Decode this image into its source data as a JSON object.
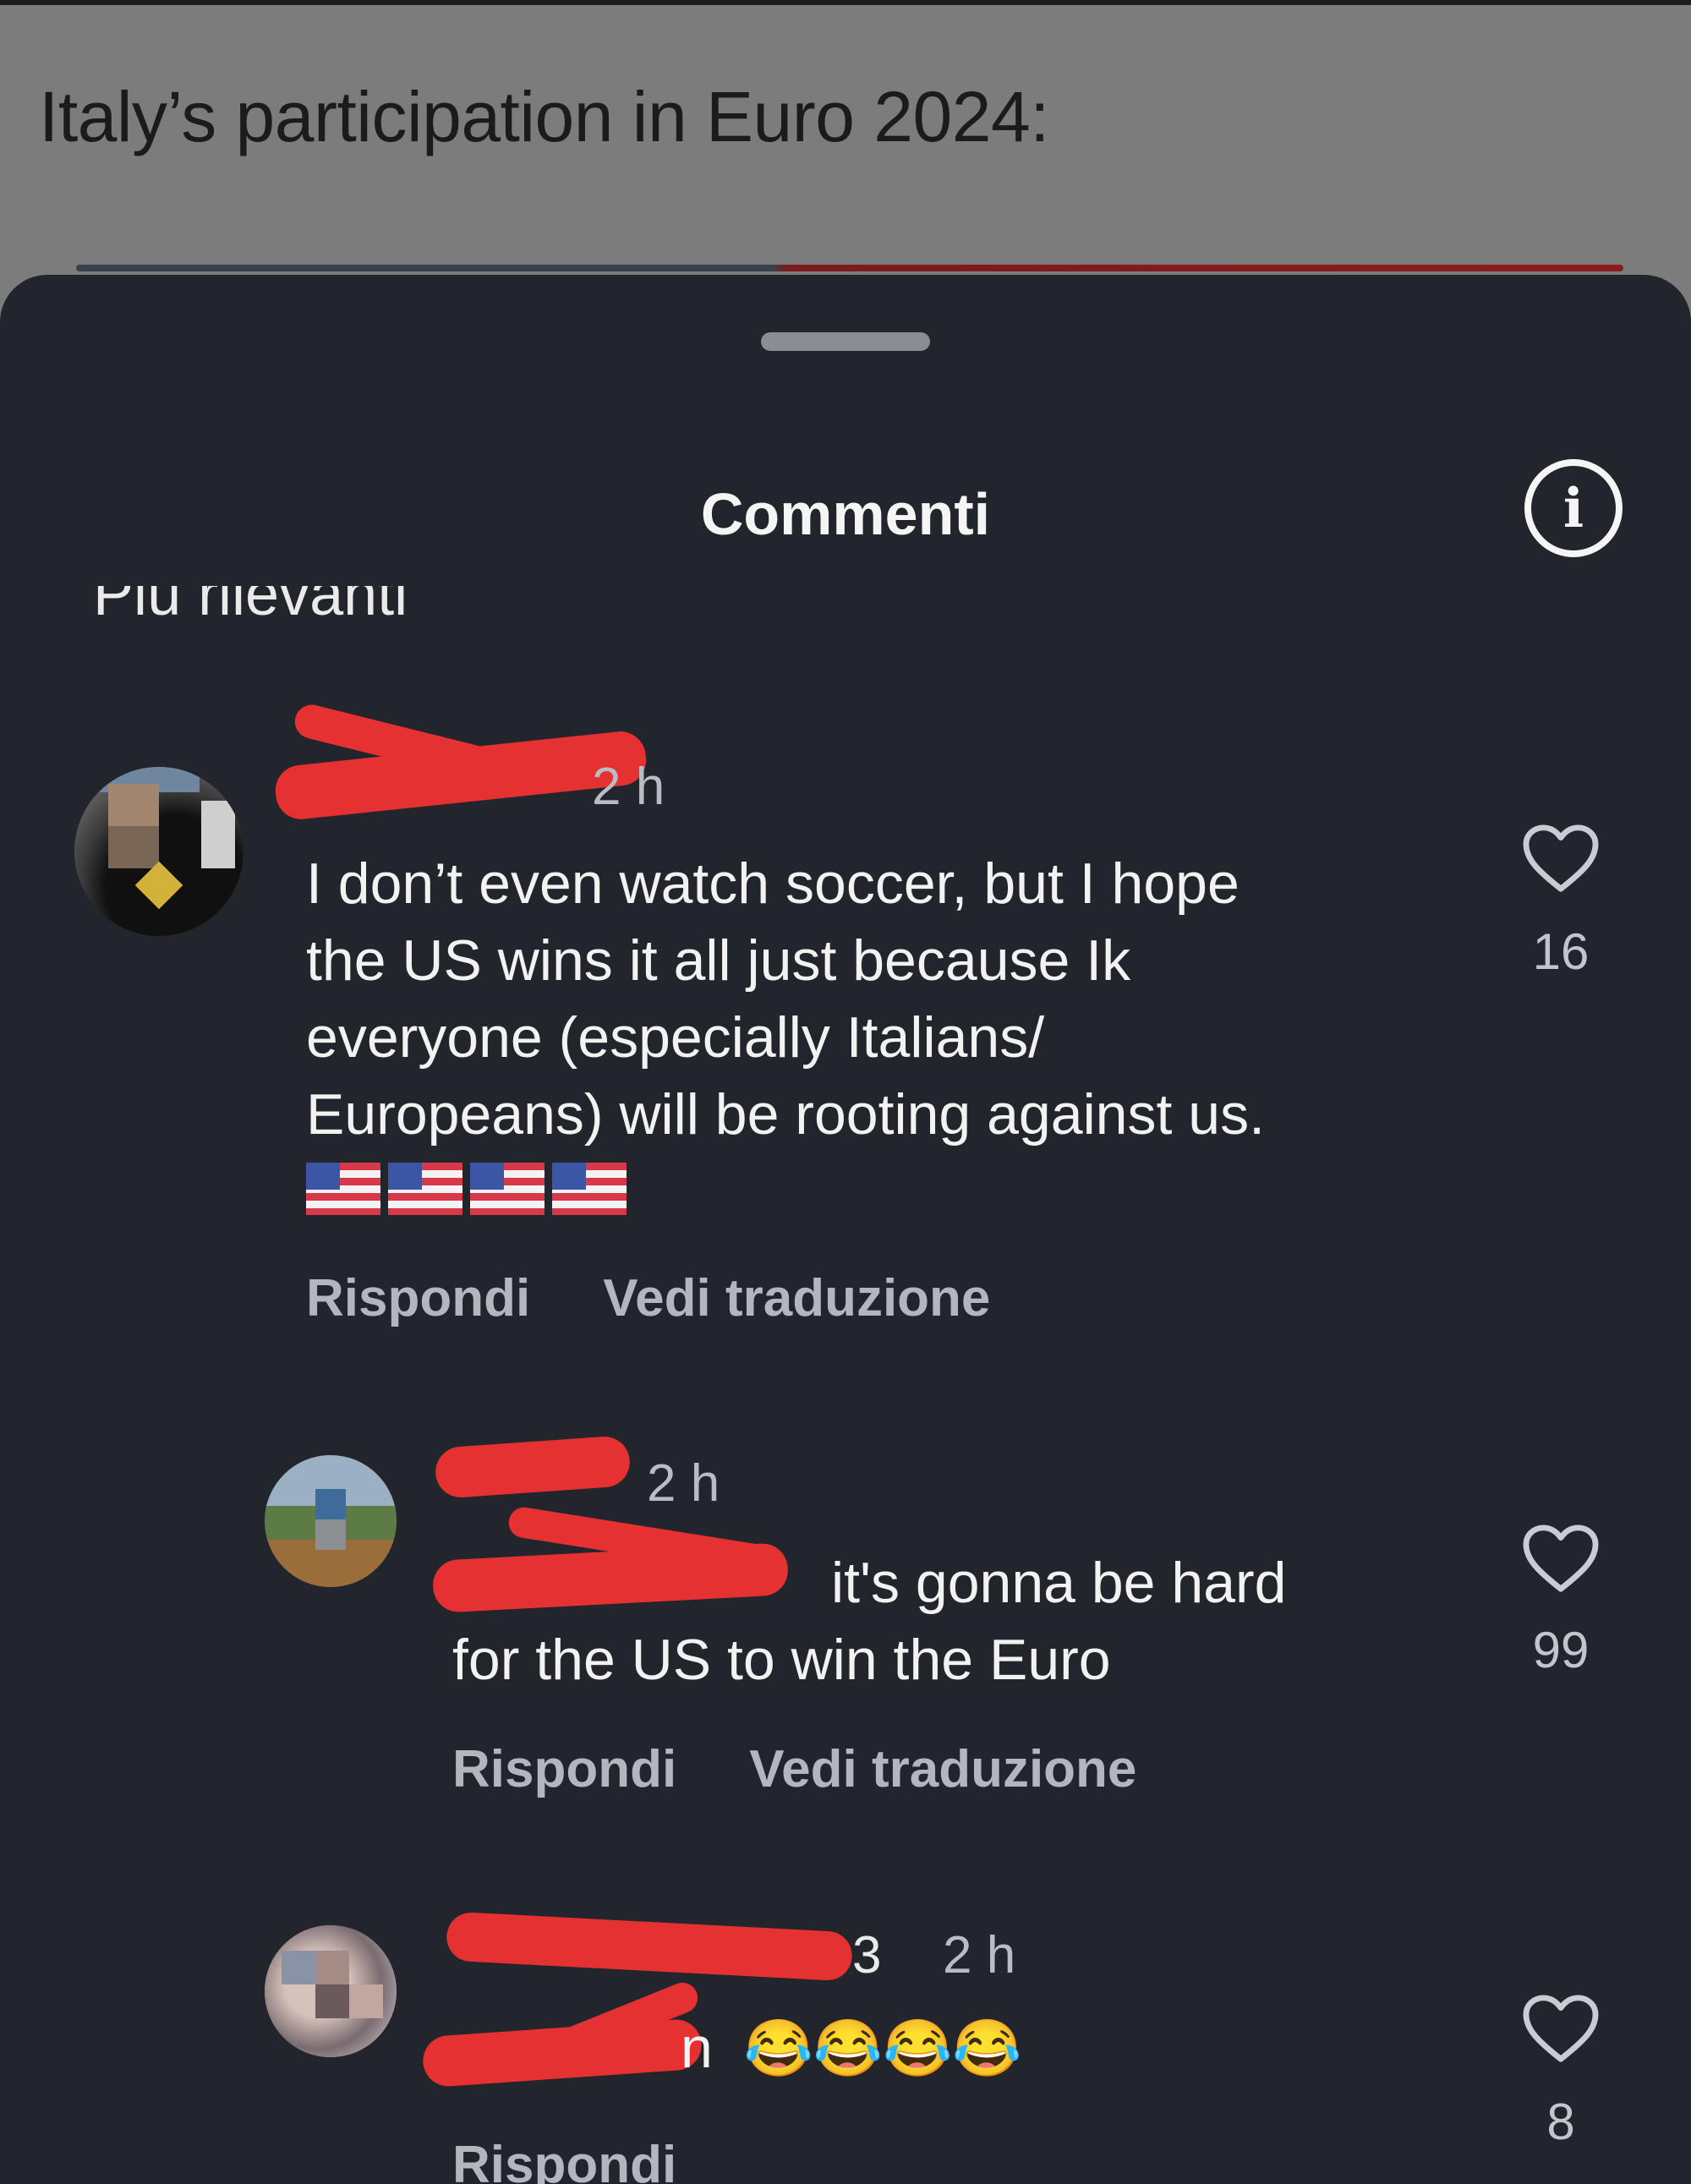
{
  "post": {
    "caption": "Italy’s participation in Euro 2024:"
  },
  "comments_sheet": {
    "title": "Commenti",
    "info_icon": "info-icon",
    "sort_label_cut": "Più rilevanti"
  },
  "comments": [
    {
      "username": "",
      "time": "2 h",
      "text_lines": [
        "I don’t even watch soccer, but I hope",
        "the US wins it all just because Ik",
        "everyone (especially Italians/",
        "Europeans) will be rooting against us."
      ],
      "emoji": "🇺🇸🇺🇸🇺🇸🇺🇸",
      "reply_label": "Rispondi",
      "translate_label": "Vedi traduzione",
      "likes": "16"
    },
    {
      "username": "",
      "time": "2 h",
      "text_lines": [
        "it's gonna be hard",
        "for the US to win the Euro"
      ],
      "reply_label": "Rispondi",
      "translate_label": "Vedi traduzione",
      "likes": "99"
    },
    {
      "username_suffix": "3",
      "time": "2 h",
      "mention_suffix": "n",
      "emoji": "😂😂😂😂",
      "reply_label": "Rispondi",
      "likes": "8"
    }
  ],
  "colors": {
    "sheet_background": "#23252c",
    "post_background": "#7c7c7c",
    "redaction": "#e53131",
    "text_primary": "#f2f2f2",
    "text_secondary": "#b3b6bd"
  }
}
